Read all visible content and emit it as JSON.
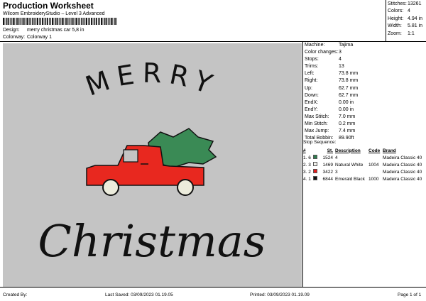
{
  "header": {
    "title": "Production Worksheet",
    "subtitle": "Wilcom EmbroideryStudio – Level 3 Advanced",
    "barcode_tail": ",",
    "design_label": "Design:",
    "design_value": "merry christmas car 5,8 in",
    "colorway_label": "Colorway:",
    "colorway_value": "Colorway 1"
  },
  "stats": [
    {
      "label": "Stitches:",
      "value": "13261"
    },
    {
      "label": "Colors:",
      "value": "4"
    },
    {
      "label": "Height:",
      "value": "4.94 in"
    },
    {
      "label": "Width:",
      "value": "5.81 in"
    },
    {
      "label": "Zoom:",
      "value": "1:1"
    }
  ],
  "info": [
    {
      "label": "Machine:",
      "value": "Tajima"
    },
    {
      "label": "Color changes:",
      "value": "3"
    },
    {
      "label": "Stops:",
      "value": "4"
    },
    {
      "label": "Trims:",
      "value": "13"
    },
    {
      "label": "Left:",
      "value": "73.8 mm"
    },
    {
      "label": "Right:",
      "value": "73.8 mm"
    },
    {
      "label": "Up:",
      "value": "62.7 mm"
    },
    {
      "label": "Down:",
      "value": "62.7 mm"
    },
    {
      "label": "EndX:",
      "value": "0.00 in"
    },
    {
      "label": "EndY:",
      "value": "0.00 in"
    },
    {
      "label": "Max Stitch:",
      "value": "7.0 mm"
    },
    {
      "label": "Min Stitch:",
      "value": "0.2 mm"
    },
    {
      "label": "Max Jump:",
      "value": "7.4 mm"
    },
    {
      "label": "Total Bobbin:",
      "value": "89.90ft"
    }
  ],
  "sequence": {
    "title": "Stop Sequence:",
    "columns": {
      "index": "#",
      "st": "St.",
      "description": "Description",
      "code": "Code",
      "brand": "Brand"
    },
    "rows": [
      {
        "index": "1.",
        "num": "6",
        "color": "#2e7d4f",
        "st": "1524",
        "description": "4",
        "code": "",
        "brand": "Madeira Classic 40"
      },
      {
        "index": "2.",
        "num": "3",
        "color": "#f2f2ec",
        "st": "1469",
        "description": "Natural White",
        "code": "1004",
        "brand": "Madeira Classic 40"
      },
      {
        "index": "3.",
        "num": "2",
        "color": "#e51d1d",
        "st": "3422",
        "description": "3",
        "code": "",
        "brand": "Madeira Classic 40"
      },
      {
        "index": "4.",
        "num": "1",
        "color": "#111111",
        "st": "6844",
        "description": "Emerald Black",
        "code": "1000",
        "brand": "Madeira Classic 40"
      }
    ]
  },
  "design": {
    "word1": "MERRY",
    "word2": "Christmas",
    "truck_color": "#e8281f",
    "tree_color": "#3a8a55",
    "outline_color": "#111111",
    "wheel_color": "#ececdc"
  },
  "footer": {
    "created_by": "Created By:",
    "last_saved": "Last Saved: 03/09/2023 01.19.05",
    "printed": "Printed: 03/09/2023 01.19.09",
    "page": "Page 1 of 1"
  }
}
